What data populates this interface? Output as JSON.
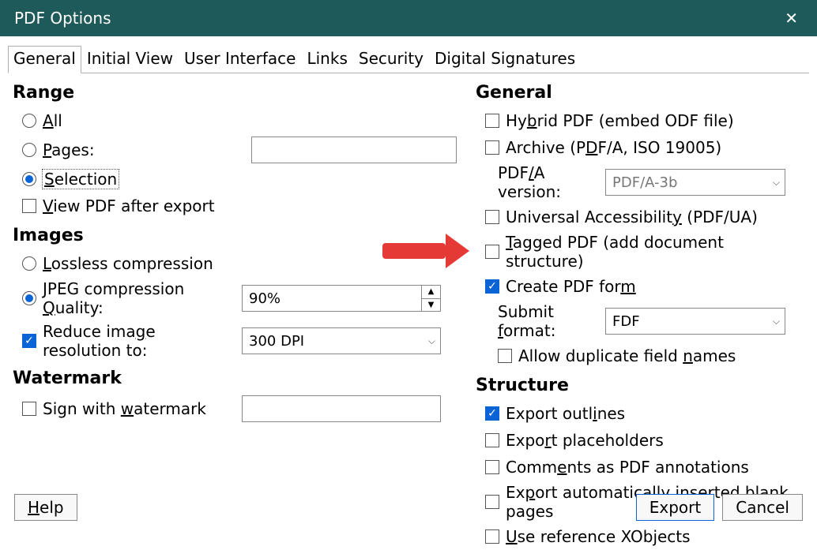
{
  "window": {
    "title": "PDF Options"
  },
  "tabs": [
    "General",
    "Initial View",
    "User Interface",
    "Links",
    "Security",
    "Digital Signatures"
  ],
  "left": {
    "range": {
      "header": "Range",
      "all": "All",
      "pages": "Pages:",
      "selection": "Selection",
      "view_after": "View PDF after export",
      "pages_value": ""
    },
    "images": {
      "header": "Images",
      "lossless": "Lossless compression",
      "jpeg": "JPEG compression Quality:",
      "jpeg_value": "90%",
      "reduce": "Reduce image resolution to:",
      "reduce_value": "300 DPI"
    },
    "watermark": {
      "header": "Watermark",
      "sign": "Sign with watermark",
      "value": ""
    }
  },
  "right": {
    "general": {
      "header": "General",
      "hybrid": "Hybrid PDF (embed ODF file)",
      "archive": "Archive (PDF/A, ISO 19005)",
      "pdfa_label": "PDF/A version:",
      "pdfa_value": "PDF/A-3b",
      "ua": "Universal Accessibility (PDF/UA)",
      "tagged": "Tagged PDF (add document structure)",
      "create_form": "Create PDF form",
      "submit_label": "Submit format:",
      "submit_value": "FDF",
      "dup_names": "Allow duplicate field names"
    },
    "structure": {
      "header": "Structure",
      "outlines": "Export outlines",
      "placeholders": "Export placeholders",
      "comments": "Comments as PDF annotations",
      "blank": "Export automatically inserted blank pages",
      "xobjects": "Use reference XObjects"
    }
  },
  "buttons": {
    "help": "Help",
    "export": "Export",
    "cancel": "Cancel"
  }
}
